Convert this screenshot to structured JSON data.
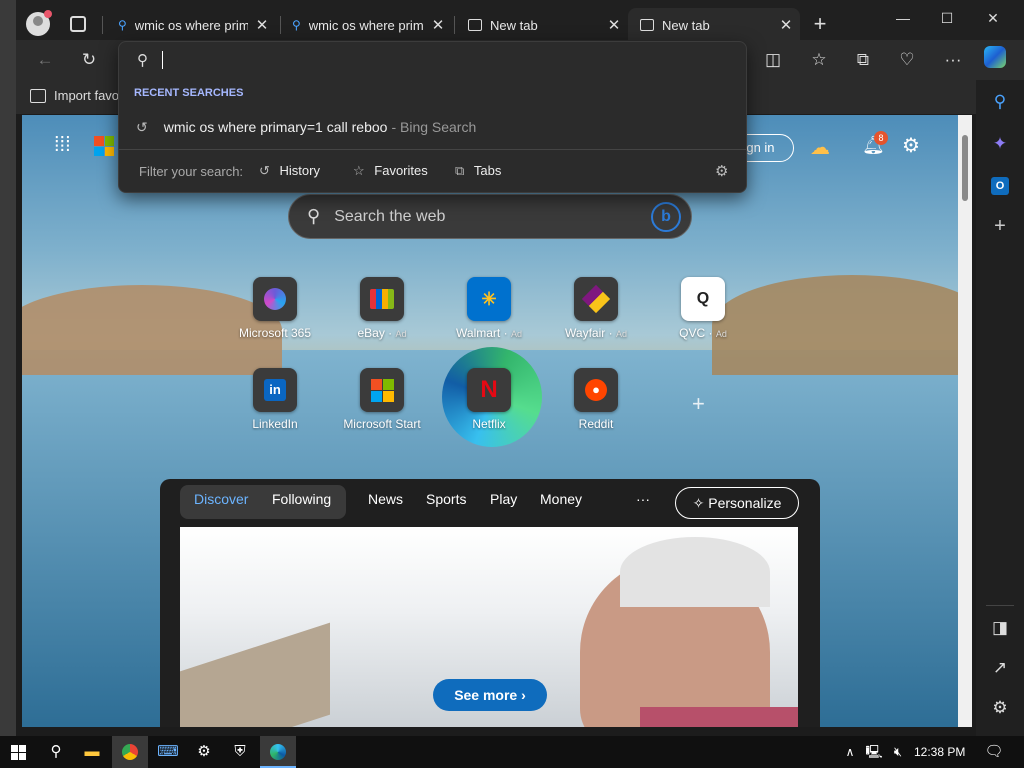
{
  "tabs": [
    {
      "label": "wmic os where primar",
      "icon": "search-icon"
    },
    {
      "label": "wmic os where prima",
      "icon": "search-icon"
    },
    {
      "label": "New tab",
      "icon": "newtab-icon"
    },
    {
      "label": "New tab",
      "icon": "newtab-icon",
      "active": true
    }
  ],
  "favorites_bar": {
    "import_label": "Import favo"
  },
  "address_dropdown": {
    "section_title": "RECENT SEARCHES",
    "recent": [
      {
        "query": "wmic os where primary=1 call reboo",
        "source": "- Bing Search"
      }
    ],
    "filter_label": "Filter your search:",
    "filters": [
      "History",
      "Favorites",
      "Tabs"
    ]
  },
  "newtab": {
    "signin_label": "ign in",
    "notification_count": "8",
    "search_placeholder": "Search the web",
    "tiles_row1": [
      {
        "label": "Microsoft 365",
        "ad": ""
      },
      {
        "label": "eBay",
        "ad": "Ad"
      },
      {
        "label": "Walmart",
        "ad": "Ad"
      },
      {
        "label": "Wayfair",
        "ad": "Ad"
      },
      {
        "label": "QVC",
        "ad": "Ad"
      }
    ],
    "tiles_row2": [
      {
        "label": "LinkedIn"
      },
      {
        "label": "Microsoft Start"
      },
      {
        "label": "Netflix"
      },
      {
        "label": "Reddit"
      }
    ],
    "feed": {
      "tabs_pill": [
        "Discover",
        "Following"
      ],
      "tabs": [
        "News",
        "Sports",
        "Play",
        "Money"
      ],
      "more": "···",
      "personalize": "Personalize",
      "see_more": "See more"
    }
  },
  "taskbar": {
    "time": "12:38 PM"
  },
  "colors": {
    "accent": "#0f6cbd",
    "frame": "#202020",
    "toolbar": "#2b2b2b"
  }
}
